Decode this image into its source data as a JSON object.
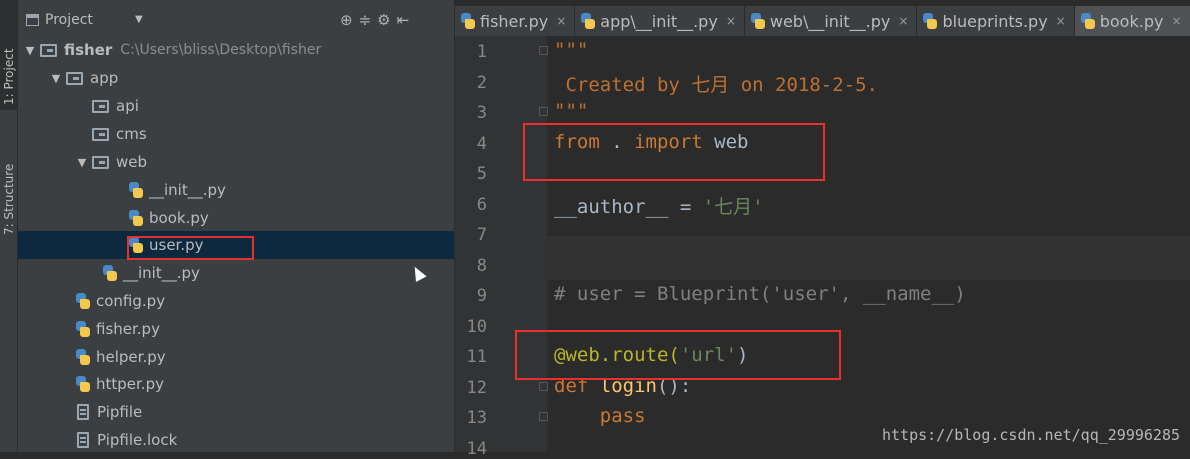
{
  "toolstrip": {
    "project_tab": "1: Project",
    "structure_tab": "7: Structure"
  },
  "panel": {
    "title": "Project",
    "dropdown_icon": "triangle-down",
    "tools": [
      "⊕",
      "≑",
      "⚙",
      "⇤"
    ]
  },
  "tree": [
    {
      "name": "fisher",
      "path": "C:\\Users\\bliss\\Desktop\\fisher",
      "type": "folder",
      "arrow": "▼",
      "bold": true
    },
    {
      "name": "app",
      "type": "folder",
      "arrow": "▼"
    },
    {
      "name": "api",
      "type": "folder",
      "arrow": ""
    },
    {
      "name": "cms",
      "type": "folder",
      "arrow": ""
    },
    {
      "name": "web",
      "type": "folder",
      "arrow": "▼"
    },
    {
      "name": "__init__.py",
      "type": "py"
    },
    {
      "name": "book.py",
      "type": "py"
    },
    {
      "name": "user.py",
      "type": "py",
      "selected": true
    },
    {
      "name": "__init__.py",
      "type": "py"
    },
    {
      "name": "config.py",
      "type": "py"
    },
    {
      "name": "fisher.py",
      "type": "py"
    },
    {
      "name": "helper.py",
      "type": "py"
    },
    {
      "name": "httper.py",
      "type": "py"
    },
    {
      "name": "Pipfile",
      "type": "file"
    },
    {
      "name": "Pipfile.lock",
      "type": "file"
    }
  ],
  "tabs": [
    {
      "label": "fisher.py",
      "close": "×"
    },
    {
      "label": "app\\__init__.py",
      "close": "×"
    },
    {
      "label": "web\\__init__.py",
      "close": "×"
    },
    {
      "label": "blueprints.py",
      "close": "×"
    },
    {
      "label": "book.py",
      "close": "×",
      "active": true
    }
  ],
  "editor": {
    "line_numbers": [
      "1",
      "2",
      "3",
      "4",
      "5",
      "6",
      "7",
      "8",
      "9",
      "10",
      "11",
      "12",
      "13",
      "14"
    ],
    "lines": {
      "l1": "\"\"\"",
      "l2": " Created by 七月 on 2018-2-5.",
      "l3": "\"\"\"",
      "l4_kw1": "from",
      "l4_mid": " . ",
      "l4_kw2": "import",
      "l4_end": " web",
      "l6_a": "__author__ = ",
      "l6_b": "'七月'",
      "l9": "# user = Blueprint('user', __name__)",
      "l11_a": "@web.route(",
      "l11_b": "'url'",
      "l11_c": ")",
      "l12_kw": "def",
      "l12_fn": " login",
      "l12_end": "():",
      "l13": "    pass"
    }
  },
  "watermark": "https://blog.csdn.net/qq_29996285",
  "colors": {
    "highlight_box": "#e8302c",
    "selection": "#0d293e",
    "editor_bg": "#2b2b2b"
  }
}
